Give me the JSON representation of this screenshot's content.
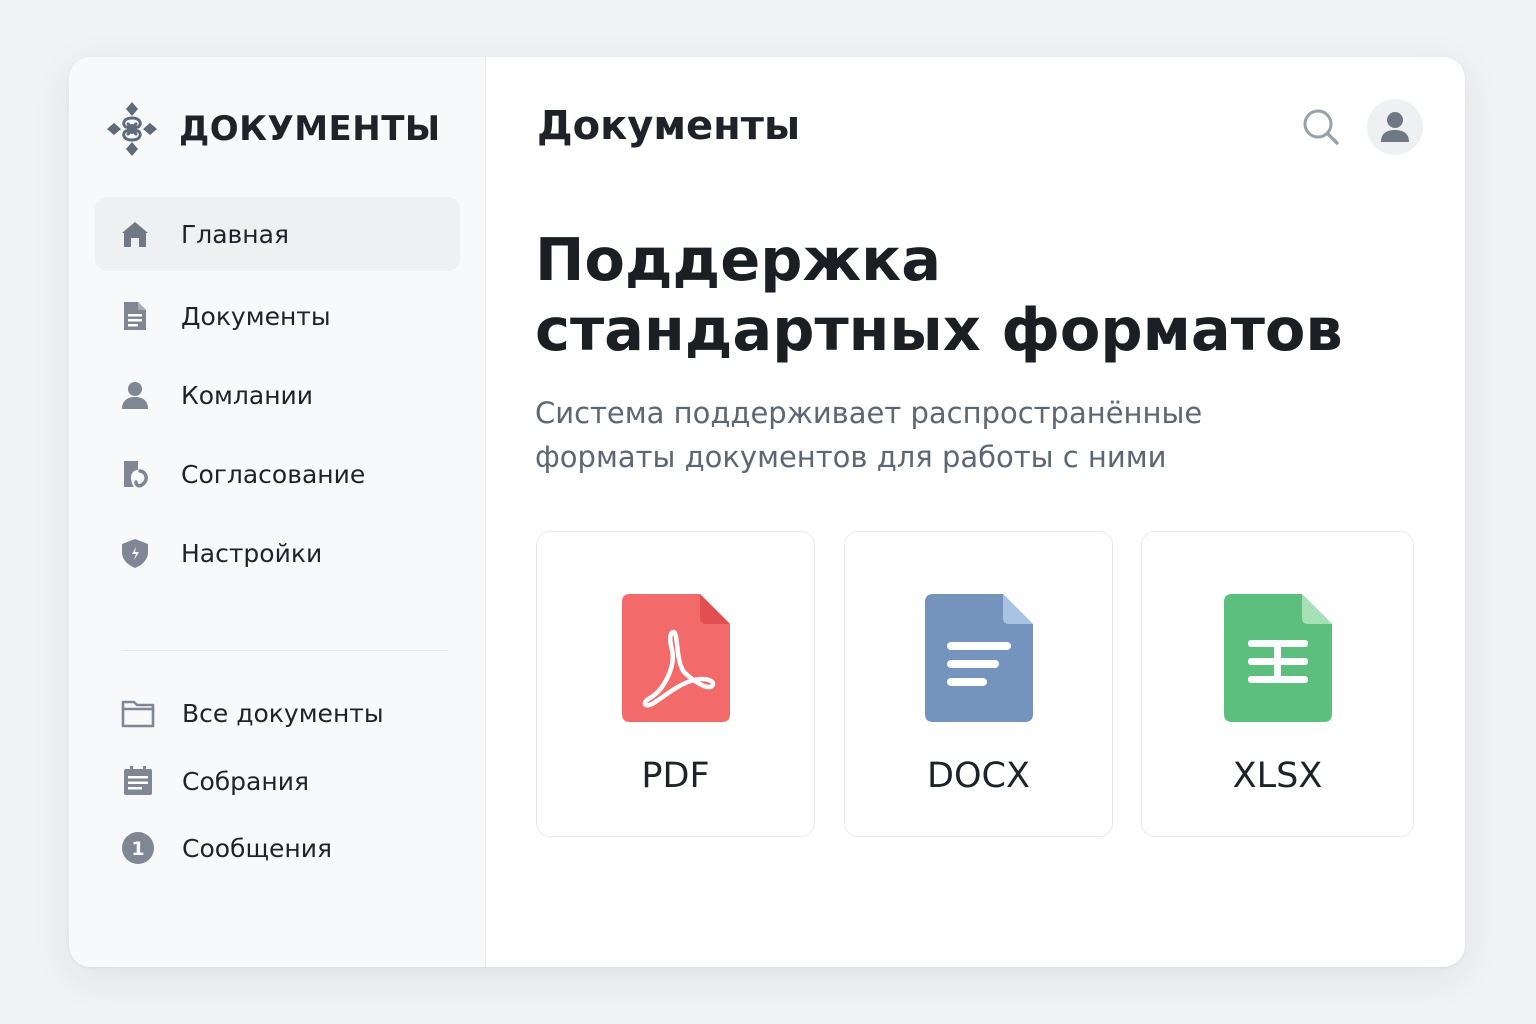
{
  "brand": {
    "name": "ДОКУМЕНТЫ",
    "logo_icon": "ornament-logo-icon"
  },
  "sidebar": {
    "nav": [
      {
        "label": "Главная",
        "icon": "home-icon",
        "active": true
      },
      {
        "label": "Документы",
        "icon": "document-icon",
        "active": false
      },
      {
        "label": "Комлании",
        "icon": "user-icon",
        "active": false
      },
      {
        "label": "Согласование",
        "icon": "approval-icon",
        "active": false
      },
      {
        "label": "Настройки",
        "icon": "shield-icon",
        "active": false
      }
    ],
    "secondary": [
      {
        "label": "Все документы",
        "icon": "folder-icon"
      },
      {
        "label": "Собрания",
        "icon": "calendar-list-icon"
      },
      {
        "label": "Сообщения",
        "icon": "notification-count-icon",
        "badge": "1"
      }
    ]
  },
  "header": {
    "title": "Документы",
    "search_icon": "search-icon",
    "avatar_icon": "user-avatar-icon"
  },
  "hero": {
    "headline": "Поддержка стандартных форматов",
    "description": "Система поддерживает распространённые форматы документов для работы с ними"
  },
  "formats": [
    {
      "label": "PDF",
      "icon": "pdf-file-icon",
      "color": "#f26a6a"
    },
    {
      "label": "DOCX",
      "icon": "docx-file-icon",
      "color": "#7594bd"
    },
    {
      "label": "XLSX",
      "icon": "xlsx-file-icon",
      "color": "#5cbf7e"
    }
  ],
  "colors": {
    "background": "#f1f2f4",
    "sidebar_bg": "#f8f9fa",
    "active_item_bg": "#eef0f2",
    "icon_gray": "#7e8793",
    "text_primary": "#1f2329",
    "text_secondary": "#5d6673"
  }
}
